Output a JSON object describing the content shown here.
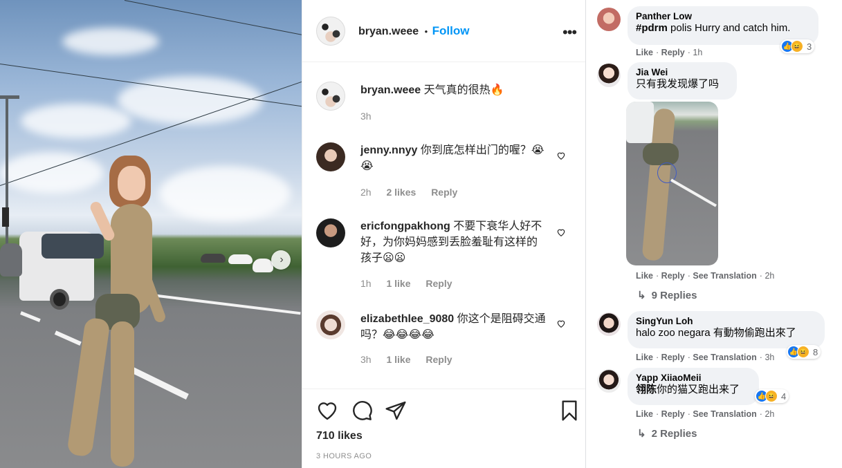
{
  "instagram": {
    "header": {
      "username": "bryan.weee",
      "separator": "•",
      "follow_label": "Follow",
      "more_label": "•••"
    },
    "caption": {
      "username": "bryan.weee",
      "text": "天气真的很热🔥",
      "time": "3h"
    },
    "comments": [
      {
        "username": "jenny.nnyy",
        "text": "你到底怎样出门的喔？😭😭",
        "time": "2h",
        "likes": "2 likes",
        "reply": "Reply"
      },
      {
        "username": "ericfongpakhong",
        "text": "不要下衰华人好不好，为你妈妈感到丢脸羞耻有这样的孩子😦😦",
        "time": "1h",
        "likes": "1 like",
        "reply": "Reply"
      },
      {
        "username": "elizabethlee_9080",
        "text": "你这个是阻碍交通吗？😂😂😂😂",
        "time": "3h",
        "likes": "1 like",
        "reply": "Reply"
      }
    ],
    "likes_count": "710 likes",
    "posted": "3 HOURS AGO",
    "icons": [
      "heart-icon",
      "comment-icon",
      "share-icon",
      "bookmark-icon"
    ]
  },
  "facebook": {
    "comments": [
      {
        "name": "Panther Low",
        "tag": "#pdrm",
        "text": " polis Hurry and catch him.",
        "meta": [
          "Like",
          "Reply"
        ],
        "time": "1h",
        "reactions": "3"
      },
      {
        "name": "Jia Wei",
        "text": "只有我发现爆了吗",
        "meta": [
          "Like",
          "Reply",
          "See Translation"
        ],
        "time": "2h",
        "replies": "9 Replies"
      },
      {
        "name": "SingYun Loh",
        "text": "halo zoo negara 有動物偷跑出來了",
        "meta": [
          "Like",
          "Reply",
          "See Translation"
        ],
        "time": "3h",
        "reactions": "8"
      },
      {
        "name": "Yapp XiiaoMeii",
        "tag": "翎陈",
        "text": "你的猫又跑出来了",
        "meta": [
          "Like",
          "Reply",
          "See Translation"
        ],
        "time": "2h",
        "reactions": "4",
        "replies": "2 Replies"
      }
    ],
    "separator": "·"
  },
  "colors": {
    "ig_blue": "#0095f6",
    "ig_gray": "#8e8e8e",
    "fb_bubble": "#f0f2f5",
    "fb_meta": "#65676b",
    "fb_like": "#1877f2"
  }
}
